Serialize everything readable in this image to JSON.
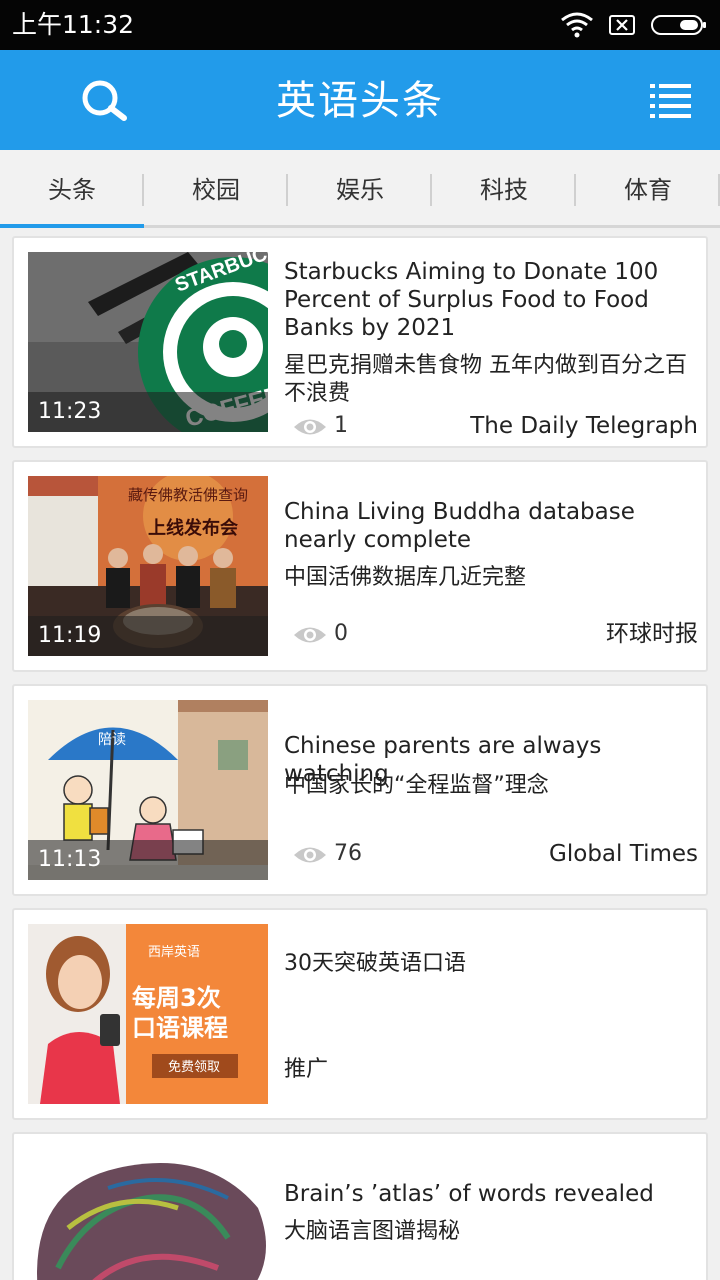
{
  "status_bar": {
    "time": "上午11:32"
  },
  "header": {
    "title": "英语头条"
  },
  "tabs": [
    {
      "label": "头条",
      "active": true
    },
    {
      "label": "校园"
    },
    {
      "label": "娱乐"
    },
    {
      "label": "科技"
    },
    {
      "label": "体育"
    }
  ],
  "articles": [
    {
      "time": "11:23",
      "title_en": "Starbucks Aiming to Donate 100 Percent of Surplus Food to Food Banks by 2021",
      "title_cn": "星巴克捐赠未售食物 五年内做到百分之百不浪费",
      "views": "1",
      "source": "The Daily Telegraph",
      "thumb_text": {
        "line1": "STARBUCKS",
        "line2": "COFFEE"
      }
    },
    {
      "time": "11:19",
      "title_en": "China Living Buddha database nearly complete",
      "title_cn": "中国活佛数据库几近完整",
      "views": "0",
      "source": "环球时报",
      "thumb_text": {
        "line1": "藏传佛教活佛查询",
        "line2": "上线发布会"
      }
    },
    {
      "time": "11:13",
      "title_en": "Chinese parents are always watching",
      "title_cn": "中国家长的“全程监督”理念",
      "views": "76",
      "source": "Global Times",
      "thumb_text": {
        "umbrella": "陪读"
      }
    },
    {
      "title_cn": "30天突破英语口语",
      "label": "推广",
      "thumb_text": {
        "brand": "西岸英语",
        "line1": "每周3次",
        "line2": "口语课程",
        "cta": "免费领取"
      }
    },
    {
      "title_en": "Brain’s ’atlas’ of words revealed",
      "title_cn": "大脑语言图谱揭秘"
    }
  ],
  "colors": {
    "accent": "#229bea",
    "status_bar": "#050505",
    "page_bg": "#f0f0f0"
  },
  "icons": [
    "wifi-icon",
    "sim-off-icon",
    "battery-icon",
    "search-icon",
    "menu-icon",
    "eye-icon"
  ]
}
